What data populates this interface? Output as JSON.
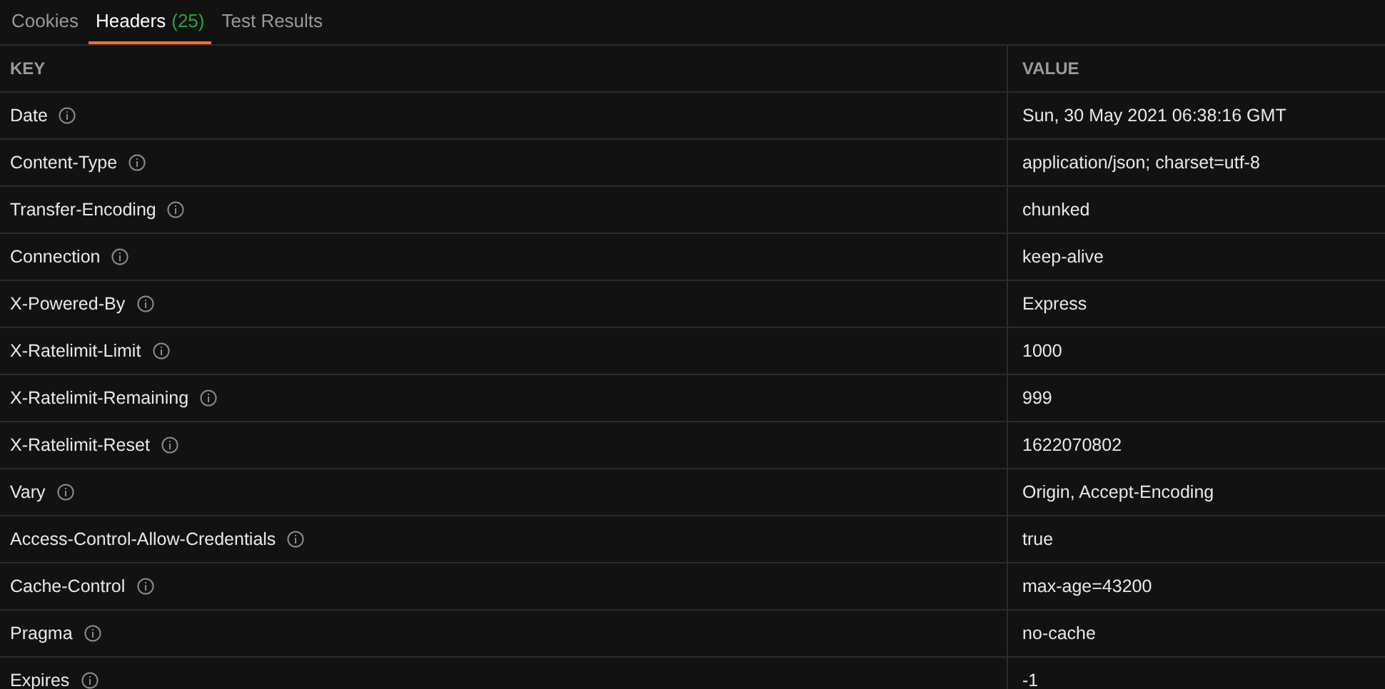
{
  "tabs": [
    {
      "label": "Cookies",
      "selected": false
    },
    {
      "label": "Headers",
      "count": "(25)",
      "selected": true
    },
    {
      "label": "Test Results",
      "selected": false
    }
  ],
  "table": {
    "columns": [
      "KEY",
      "VALUE"
    ],
    "rows": [
      {
        "key": "Date",
        "value": "Sun, 30 May 2021 06:38:16 GMT"
      },
      {
        "key": "Content-Type",
        "value": "application/json; charset=utf-8"
      },
      {
        "key": "Transfer-Encoding",
        "value": "chunked"
      },
      {
        "key": "Connection",
        "value": "keep-alive"
      },
      {
        "key": "X-Powered-By",
        "value": "Express"
      },
      {
        "key": "X-Ratelimit-Limit",
        "value": "1000"
      },
      {
        "key": "X-Ratelimit-Remaining",
        "value": "999"
      },
      {
        "key": "X-Ratelimit-Reset",
        "value": "1622070802"
      },
      {
        "key": "Vary",
        "value": "Origin, Accept-Encoding"
      },
      {
        "key": "Access-Control-Allow-Credentials",
        "value": "true"
      },
      {
        "key": "Cache-Control",
        "value": "max-age=43200"
      },
      {
        "key": "Pragma",
        "value": "no-cache"
      },
      {
        "key": "Expires",
        "value": "-1"
      }
    ]
  }
}
